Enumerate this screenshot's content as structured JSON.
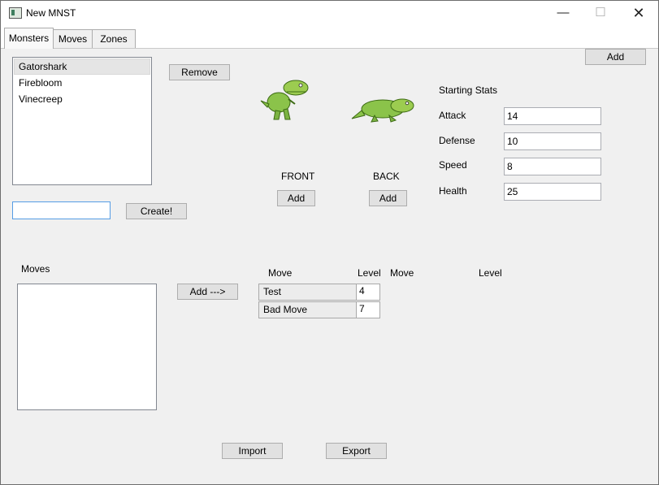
{
  "window": {
    "title": "New MNST",
    "minimize_glyph": "—",
    "maximize_glyph": "☐",
    "close_glyph": "✕"
  },
  "tabs": [
    {
      "label": "Monsters",
      "active": true
    },
    {
      "label": "Moves",
      "active": false
    },
    {
      "label": "Zones",
      "active": false
    }
  ],
  "monsters": {
    "list": [
      "Gatorshark",
      "Firebloom",
      "Vinecreep"
    ],
    "selected_index": 0,
    "remove_label": "Remove",
    "add_label": "Add",
    "create_input_value": "",
    "create_label": "Create!"
  },
  "sprites": {
    "front_label": "FRONT",
    "back_label": "BACK",
    "front_add_label": "Add",
    "back_add_label": "Add"
  },
  "stats": {
    "heading": "Starting Stats",
    "rows": [
      {
        "label": "Attack",
        "value": "14"
      },
      {
        "label": "Defense",
        "value": "10"
      },
      {
        "label": "Speed",
        "value": "8"
      },
      {
        "label": "Health",
        "value": "25"
      }
    ]
  },
  "moves": {
    "label": "Moves",
    "add_label": "Add --->",
    "columns": [
      "Move",
      "Level",
      "Move",
      "Level"
    ],
    "learned": [
      {
        "move": "Test",
        "level": "4"
      },
      {
        "move": "Bad Move",
        "level": "7"
      }
    ]
  },
  "footer": {
    "import_label": "Import",
    "export_label": "Export"
  },
  "colors": {
    "window_bg": "#f0f0f0",
    "button_bg": "#e1e1e1",
    "focus_border": "#569de5",
    "dino_green": "#8bc34a"
  }
}
